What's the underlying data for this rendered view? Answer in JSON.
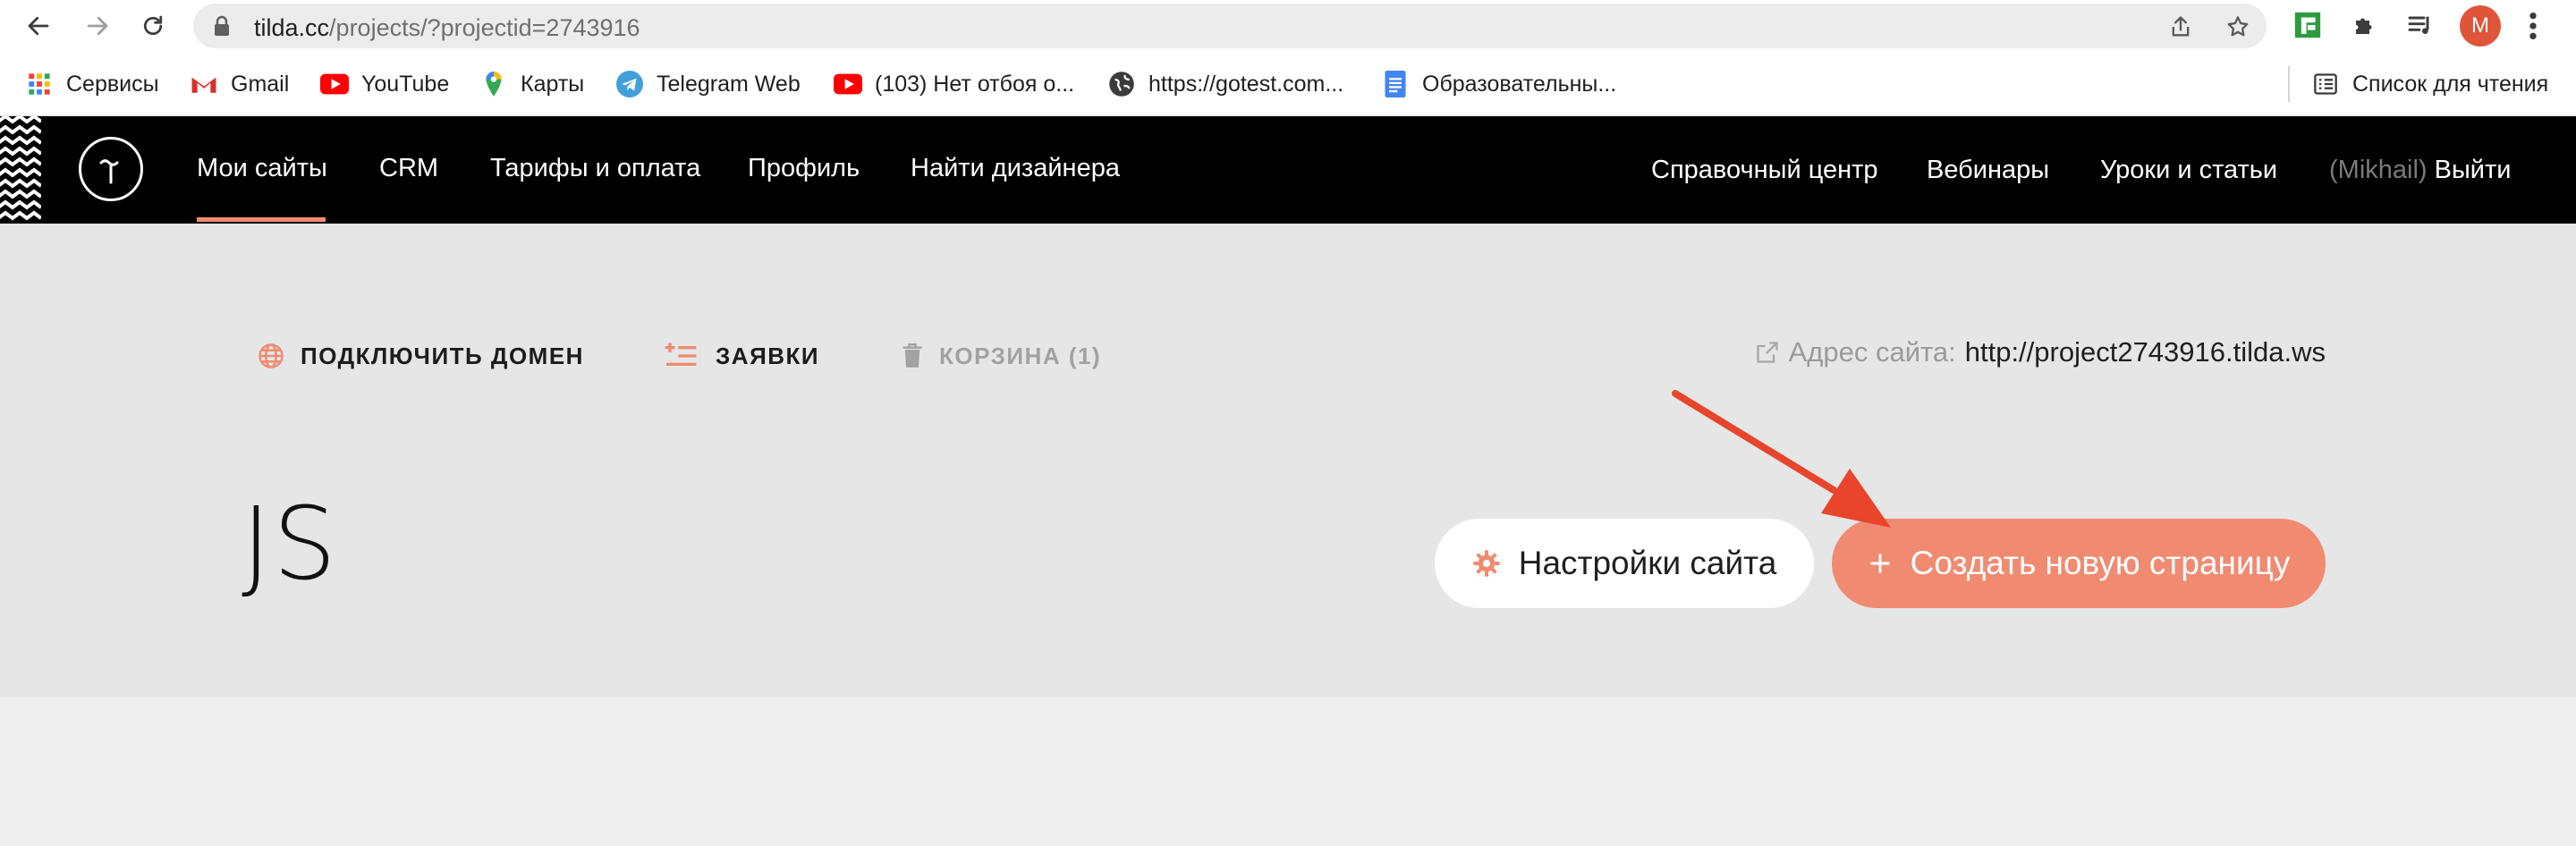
{
  "browser": {
    "url_host": "tilda.cc",
    "url_path": "/projects/?projectid=2743916",
    "avatar_letter": "M",
    "bookmarks": [
      {
        "label": "Сервисы",
        "icon": "apps-grid-icon"
      },
      {
        "label": "Gmail",
        "icon": "gmail-icon"
      },
      {
        "label": "YouTube",
        "icon": "youtube-icon"
      },
      {
        "label": "Карты",
        "icon": "maps-pin-icon"
      },
      {
        "label": "Telegram Web",
        "icon": "telegram-icon"
      },
      {
        "label": "(103) Нет отбоя о...",
        "icon": "youtube-icon"
      },
      {
        "label": "https://gotest.com...",
        "icon": "globe-icon"
      },
      {
        "label": "Образовательны...",
        "icon": "docs-icon"
      }
    ],
    "reading_list": "Список для чтения"
  },
  "header": {
    "menu": [
      "Мои сайты",
      "CRM",
      "Тарифы и оплата",
      "Профиль",
      "Найти дизайнера"
    ],
    "active_index": 0,
    "right": [
      "Справочный центр",
      "Вебинары",
      "Уроки и статьи"
    ],
    "user_name": "(Mikhail)",
    "logout": "Выйти"
  },
  "project": {
    "actions": {
      "connect_domain": "ПОДКЛЮЧИТЬ ДОМЕН",
      "leads": "ЗАЯВКИ",
      "trash": "КОРЗИНА (1)"
    },
    "site_address_label": "Адрес сайта:",
    "site_address_value": "http://project2743916.tilda.ws",
    "title": "JS",
    "settings_button": "Настройки сайта",
    "create_button": "Создать новую страницу"
  },
  "colors": {
    "accent": "#f08b72",
    "annotation_arrow": "#e8452c",
    "header_bg": "#000000",
    "project_bg": "#e6e6e6"
  }
}
